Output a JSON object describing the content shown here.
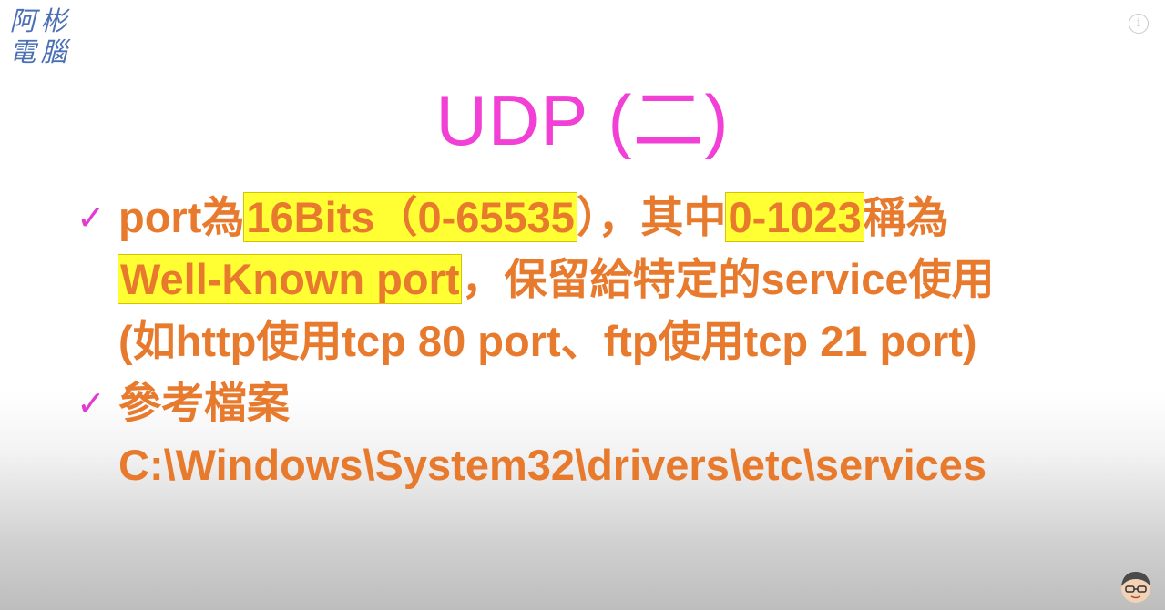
{
  "logo": {
    "chars": [
      "阿",
      "彬",
      "電",
      "腦"
    ]
  },
  "title": "UDP (二)",
  "bullets": [
    {
      "line1": {
        "part1": "port為",
        "hl1": "16Bits（0-65535",
        "part2": "），其中",
        "hl2": "0-1023",
        "part3": "稱為"
      },
      "line2": {
        "hl": "Well-Known port",
        "rest": "，保留給特定的service使用"
      },
      "line3": "(如http使用tcp 80 port、ftp使用tcp 21 port)"
    },
    {
      "line1": "參考檔案",
      "line2": "C:\\Windows\\System32\\drivers\\etc\\services"
    }
  ],
  "icons": {
    "check": "✓",
    "info": "i"
  },
  "colors": {
    "title": "#f23fd6",
    "text": "#e87a2e",
    "highlight": "#ffff33",
    "check": "#e03ccf",
    "logo": "#4a6fb5"
  }
}
